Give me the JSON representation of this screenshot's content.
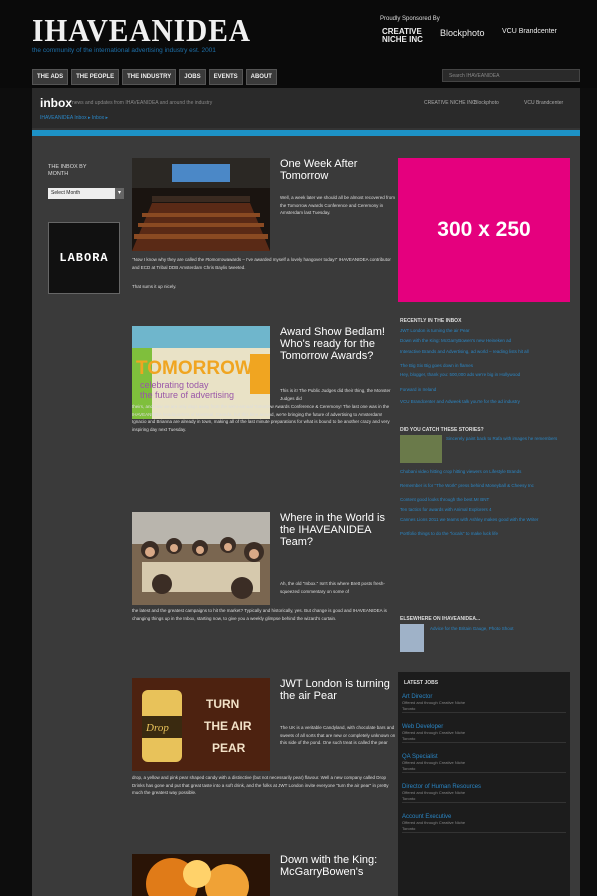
{
  "header": {
    "logo": "IHAVEANIDEA",
    "tagline": "the community of the international advertising industry est. 2001",
    "sponsored_by": "Proudly Sponsored By",
    "sponsors": [
      "CREATIVE NICHE INC",
      "Blockphoto",
      "VCU Brandcenter"
    ]
  },
  "nav": [
    "THE ADS",
    "THE PEOPLE",
    "THE INDUSTRY",
    "JOBS",
    "EVENTS",
    "ABOUT"
  ],
  "search": {
    "placeholder": "Search IHAVEANIDEA"
  },
  "inbox": {
    "title": "inbox",
    "subtitle": "news and updates from IHAVEANIDEA and around the industry",
    "breadcrumb": "IHAVEANIDEA Inbox ▸ Inbox ▸",
    "right_items": [
      "CREATIVE NICHE INC",
      "Blockphoto",
      "VCU Brandcenter"
    ]
  },
  "left": {
    "heading": "THE INBOX BY MONTH",
    "select_value": "Select Month",
    "ad_label": "LABORA"
  },
  "posts": [
    {
      "title": "One Week After Tomorrow",
      "body": "Well, a week later we should all be almost recovered from the Tomorrow Awards Conference and Ceremony in Amsterdam last Tuesday.",
      "full": "\"Now I know why they are called the #tomorrowawards – I've awarded myself a lovely hangover today!\" IHAVEANIDEA contributor and ECD at Tribal DDB Amsterdam Chris Baylis tweeted.",
      "extra": "That sums it up nicely."
    },
    {
      "title": "Award Show Bedlam! Who's ready for the Tomorrow Awards?",
      "body": "This is it! The Public Judges did their thing, the Monster Judges did",
      "full": "theirs, and now we are only days away from the semi-annual Tomorrow Awards Conference & Ceremony! The last one was in the IHAVEANIDEA headquarters of Montreal, Canada, but this time around, we're bringing the future of advertising to Amsterdam! Ignacio and Brianna are already in town, making all of the last minute preparations for what is bound to be another crazy and very inspiring day next Tuesday.",
      "image_text": [
        "TOMORROW",
        "celebrating today",
        "the future of advertising"
      ]
    },
    {
      "title": "Where in the World is the IHAVEANIDEA Team?",
      "body": "Ah, the old \"Inbox.\" Isn't this where Brett posts fresh-squeezed commentary on some of",
      "full": "the latest and the greatest campaigns to hit the market? Typically and historically, yes. But change is good and IHAVEANIDEA is changing things up in the Inbox, starting now, to give you a weekly glimpse behind the wizard's curtain."
    },
    {
      "title": "JWT London is turning the air Pear",
      "body": "The UK is a veritable Candyland, with chocolate bars and sweets of all sorts that are new or completely unknown on this side of the pond. One such treat is called the pear",
      "full": "drop, a yellow and pink pear shaped candy with a distinctive (but not necessarily pear) flavour. Well a new company called Drop Drinks has gone and put that great taste into a soft drink, and the folks at JWT London invite everyone \"turn the air pear\" in pretty much the greatest way possible.",
      "image_text": "TURN THE AIR PEAR"
    },
    {
      "title": "Down with the King: McGarryBowen's"
    }
  ],
  "right": {
    "ad_label": "300 x 250",
    "recent_heading": "RECENTLY IN THE INBOX",
    "recent": [
      "JWT London is turning the air Pear",
      "Down with the King: McGarryBowen's new Heineken ad",
      "Interactive Brands and Advertising, ad world – reading lists hit all",
      "The Big Six Big goes down in flames",
      "Hey, blogger, thank you: 500,000 ads we're big in Hollywood",
      "Forward in Ireland",
      "VCU Brandcenter and Adweek talk you're for the ad industry"
    ],
    "catch_heading": "DID YOU CATCH THESE STORIES?",
    "catch": [
      "Sincerely paint back to Rafa with images he remembers",
      "Chobani video hitting crop hitting viewers on Lifestyle Brands",
      "Remember is for \"The Work\" press behind Moneyball & Cheesy Inc",
      "Content good looks through the best.Mr BNT",
      "Ten tactics for awards with Animal Explorers 4",
      "Cannes Lions 2011 we teams with Ashley makes good with the Writer",
      "Portfolio things to do the \"locals\" to make luck life"
    ],
    "elsewhere_heading": "ELSEWHERE ON IHAVEANIDEA...",
    "elsewhere": "Advice for the Britain Gauge, Photo Shoot",
    "jobs_heading": "LATEST JOBS",
    "jobs": [
      {
        "title": "Art Director",
        "sub": "Offered and through Creative Niche",
        "loc": "Toronto"
      },
      {
        "title": "Web Developer",
        "sub": "Offered and through Creative Niche",
        "loc": "Toronto"
      },
      {
        "title": "QA Specialist",
        "sub": "Offered and through Creative Niche",
        "loc": "Toronto"
      },
      {
        "title": "Director of Human Resources",
        "sub": "Offered and through Creative Niche",
        "loc": "Toronto"
      },
      {
        "title": "Account Executive",
        "sub": "Offered and through Creative Niche",
        "loc": "Toronto"
      }
    ]
  }
}
